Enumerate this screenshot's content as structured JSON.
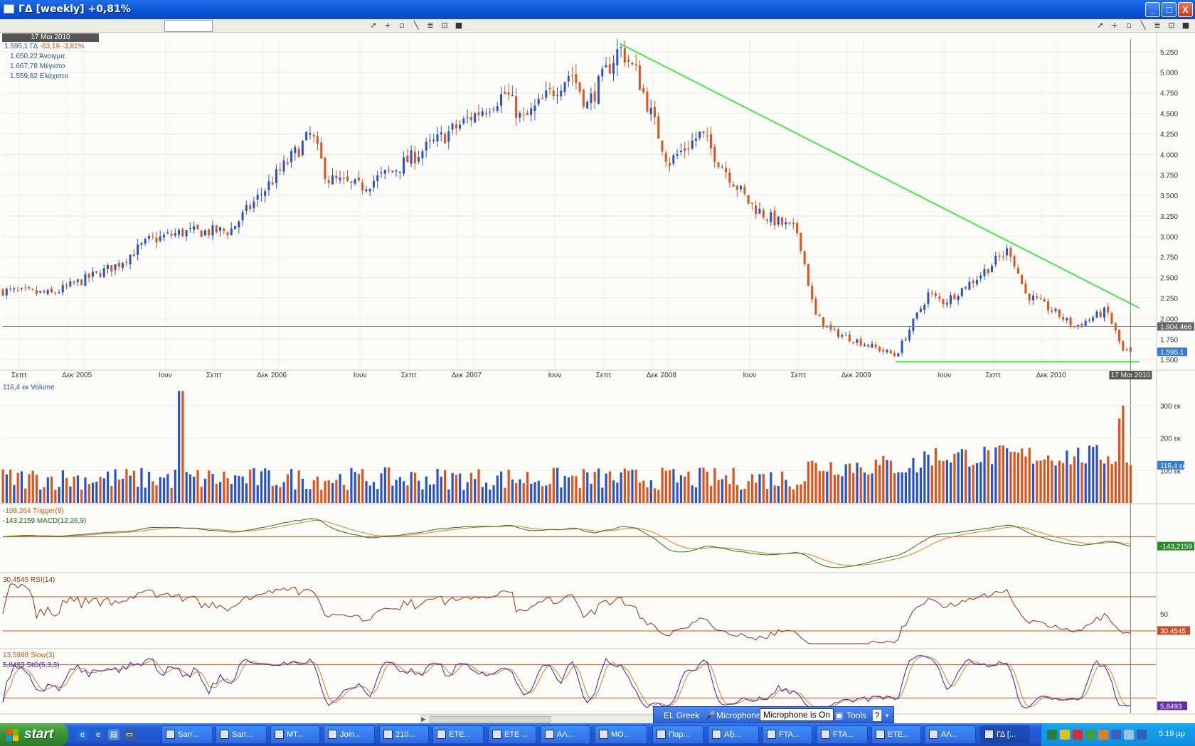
{
  "window": {
    "title": "ΓΔ [weekly] +0,81%",
    "buttons": [
      "_",
      "□",
      "X"
    ]
  },
  "toolbar": {
    "symbol_value": "",
    "icons": [
      "pointer-icon",
      "crosshair-icon",
      "rectangle-icon",
      "line-icon",
      "list-icon",
      "chart-icon",
      "save-icon"
    ]
  },
  "info_panel": {
    "date": "17 Μαι 2010",
    "price_line": "1.595,1 ΓΔ",
    "change": "-63,19 -3,81%",
    "open_line": "1.650,22 Άνοιγμα",
    "high_line": "1.667,78 Μέγιστο",
    "low_line": "1.559,82 Ελάχιστο"
  },
  "subpanes": {
    "volume_label": "116,4 εκ Volume",
    "volume_value": "116,4 εκ",
    "trigger_label": "-108,264 Trigger(9)",
    "macd_label": "-143,2159 MACD(12,26,9)",
    "macd_value": "-143,2159",
    "rsi_label": "30,4545 RSI(14)",
    "rsi_value": "30,4545",
    "rsi_mid": "50",
    "slow_label": "13,5988 Slow(3)",
    "sto_label": "5,8493 StO(5,3,3)",
    "sto_value": "5,8493"
  },
  "chart_data": [
    {
      "type": "candlestick",
      "title": "ΓΔ [weekly]",
      "x_tick_labels": [
        "Σεπτ",
        "Δεκ",
        "2005",
        "Ιουν",
        "Σεπτ",
        "Δεκ",
        "2006",
        "Ιουν",
        "Σεπτ",
        "Δεκ",
        "2007",
        "Ιουν",
        "Σεπτ",
        "Δεκ",
        "2008",
        "Ιουν",
        "Σεπτ",
        "Δεκ",
        "2009",
        "Ιουν",
        "Σεπτ",
        "Δεκ",
        "2010"
      ],
      "x_cursor_label": "17 Μαι 2010",
      "y_tick_labels": [
        "5.250",
        "5.000",
        "4.750",
        "4.500",
        "4.250",
        "4.000",
        "3.750",
        "3.500",
        "3.250",
        "3.000",
        "2.750",
        "2.500",
        "2.250",
        "2.000",
        "1.750",
        "1.500"
      ],
      "ylim": [
        1450,
        5300
      ],
      "horizontal_line_label": "1.904,466",
      "horizontal_line_value": 1904.466,
      "last_price_label": "1.595,1",
      "last_price": 1595.1,
      "colors": {
        "up": "#2a52c8",
        "down": "#e0521b",
        "trendline": "#40ee40"
      },
      "trendlines": [
        {
          "from": {
            "x": "2007-10",
            "y": 5350
          },
          "to": {
            "x": "2010-06",
            "y": 2130
          }
        },
        {
          "from": {
            "x": "2009-03",
            "y": 1475
          },
          "to": {
            "x": "2010-06",
            "y": 1475
          }
        }
      ],
      "path_date": [
        "2004-08",
        "2004-11",
        "2005-03",
        "2005-05",
        "2005-07",
        "2005-10",
        "2006-03",
        "2006-04",
        "2006-06",
        "2006-08",
        "2006-11",
        "2007-03",
        "2007-04",
        "2007-07",
        "2007-08",
        "2007-10",
        "2007-11",
        "2008-01",
        "2008-03",
        "2008-04",
        "2008-06",
        "2008-07",
        "2008-09",
        "2008-10",
        "2008-11",
        "2009-01",
        "2009-03",
        "2009-05",
        "2009-06",
        "2009-08",
        "2009-10",
        "2009-11",
        "2010-01",
        "2010-02",
        "2010-04",
        "2010-05"
      ],
      "path_close": [
        2340,
        2300,
        2650,
        2950,
        3050,
        3070,
        4250,
        3700,
        3600,
        3800,
        4200,
        4750,
        4400,
        5000,
        4600,
        5300,
        5000,
        3900,
        4250,
        3950,
        3400,
        3250,
        3050,
        2050,
        1850,
        1700,
        1550,
        2300,
        2200,
        2500,
        2850,
        2300,
        2050,
        1900,
        2100,
        1600
      ],
      "ylabel": "",
      "xlabel": ""
    },
    {
      "type": "bar",
      "title": "Volume",
      "y_tick_labels": [
        "300 εκ",
        "200 εκ",
        "100 εκ"
      ],
      "ylim": [
        0,
        350
      ],
      "last_value": 116.4
    },
    {
      "type": "line",
      "title": "MACD(12,26,9)",
      "series": [
        {
          "name": "Trigger(9)",
          "color": "#e08020"
        },
        {
          "name": "MACD(12,26,9)",
          "color": "#1f7a1f"
        }
      ],
      "last_values": {
        "trigger": -108.264,
        "macd": -143.2159
      }
    },
    {
      "type": "line",
      "title": "RSI(14)",
      "series": [
        {
          "name": "RSI(14)",
          "color": "#9a3010"
        }
      ],
      "levels": [
        70,
        50,
        30
      ],
      "last_value": 30.4545
    },
    {
      "type": "line",
      "title": "StO(5,3,3)",
      "series": [
        {
          "name": "Slow(3)",
          "color": "#e08020"
        },
        {
          "name": "StO(5,3,3)",
          "color": "#3a1fb0"
        }
      ],
      "levels": [
        80,
        20
      ],
      "last_values": {
        "slow": 13.5988,
        "sto": 5.8493
      }
    }
  ],
  "langbar": {
    "lang": "EL Greek",
    "mic": "Microphone",
    "mic_status": "Microphone is On",
    "tools": "Tools",
    "help": "?"
  },
  "taskbar": {
    "start": "start",
    "tasks": [
      "Sarr...",
      "Sarr...",
      "MT...",
      "Join...",
      "210...",
      "ETE...",
      "ETE ...",
      "ΑΛ...",
      "ΜΟ...",
      "Παρ...",
      "Αξι...",
      "FTA...",
      "FTA...",
      "ETE...",
      "ΑΛ...",
      "ΓΔ [..."
    ],
    "active_task": 15,
    "clock": "5:19 μμ"
  }
}
